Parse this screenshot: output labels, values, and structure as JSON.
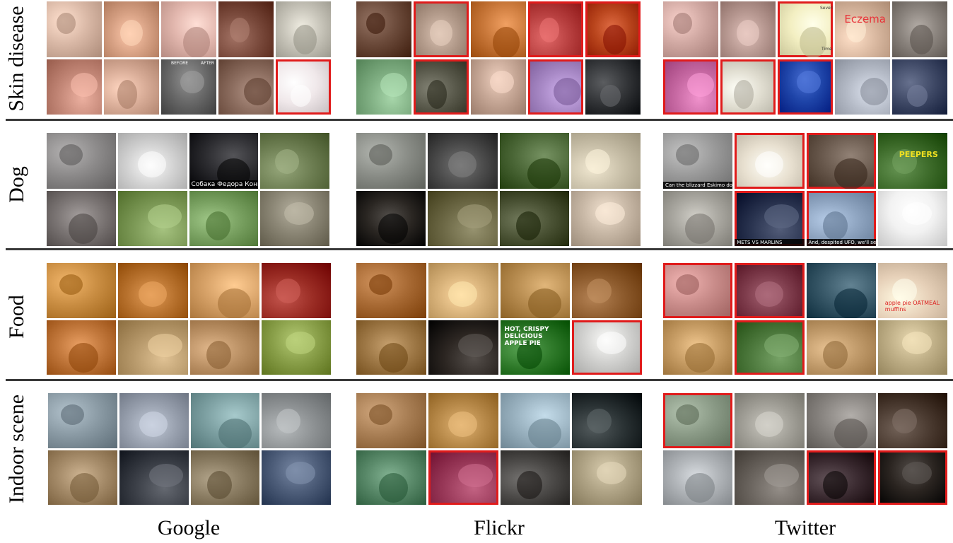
{
  "rows": [
    {
      "id": "skin",
      "label": "Skin disease"
    },
    {
      "id": "dog",
      "label": "Dog"
    },
    {
      "id": "food",
      "label": "Food"
    },
    {
      "id": "indoor",
      "label": "Indoor scene"
    }
  ],
  "columns": [
    {
      "id": "google",
      "label": "Google"
    },
    {
      "id": "flickr",
      "label": "Flickr"
    },
    {
      "id": "twitter",
      "label": "Twitter"
    }
  ],
  "image_texts": {
    "skin_google_before": "BEFORE",
    "skin_google_after": "AFTER",
    "skin_twitter_eczema": "Eczema",
    "skin_twitter_chart_severity": "Severity",
    "skin_twitter_chart_time": "Time",
    "dog_google_caption": "Собака Федора Конюхова",
    "dog_twitter_peepers": "PEEPERS",
    "dog_twitter_caption1": "Can the blizzard Eskimo dog come in so you we there?",
    "dog_twitter_caption2": "METS VS MARLINS",
    "dog_twitter_caption3": "And, despited UFO, we'll see great. You want the to - You",
    "food_flickr_box": "HOT, CRISPY DELICIOUS APPLE PIE",
    "food_twitter_muffins": "apple pie OATMEAL muffins"
  },
  "cells": {
    "skin_google": [
      {
        "c": "#d9b8a6",
        "n": false
      },
      {
        "c": "#d7a184",
        "n": false
      },
      {
        "c": "#e2b7ae",
        "n": false
      },
      {
        "c": "#7a4a3c",
        "n": false
      },
      {
        "c": "#c9c6bb",
        "n": false
      },
      {
        "c": "#c48878",
        "n": false
      },
      {
        "c": "#d9ad98",
        "n": false
      },
      {
        "c": "#6a6a6a",
        "n": false
      },
      {
        "c": "#8c6d5f",
        "n": false
      },
      {
        "c": "#f0e8ea",
        "n": true
      }
    ],
    "skin_flickr": [
      {
        "c": "#6b4a3a",
        "n": false
      },
      {
        "c": "#b29a8a",
        "n": true
      },
      {
        "c": "#c9783a",
        "n": false
      },
      {
        "c": "#b84040",
        "n": true
      },
      {
        "c": "#b8441c",
        "n": true
      },
      {
        "c": "#7fae82",
        "n": false
      },
      {
        "c": "#5a5a4c",
        "n": true
      },
      {
        "c": "#c6a796",
        "n": false
      },
      {
        "c": "#a889c6",
        "n": true
      },
      {
        "c": "#333538",
        "n": false
      }
    ],
    "skin_twitter": [
      {
        "c": "#d0a8a2",
        "n": false
      },
      {
        "c": "#b89992",
        "n": false
      },
      {
        "c": "#f3efc2",
        "n": true
      },
      {
        "c": "#d9b8a0",
        "n": false
      },
      {
        "c": "#8c857f",
        "n": false
      },
      {
        "c": "#c86aa4",
        "n": true
      },
      {
        "c": "#e0ddd0",
        "n": true
      },
      {
        "c": "#1e44a8",
        "n": true
      },
      {
        "c": "#b6bcc8",
        "n": false
      },
      {
        "c": "#3f4966",
        "n": false
      }
    ],
    "dog_google": [
      {
        "c": "#8c8a8a",
        "n": false
      },
      {
        "c": "#d2d2d2",
        "n": false
      },
      {
        "c": "#2c2c30",
        "n": false
      },
      {
        "c": "#6d7e52",
        "n": false
      },
      {
        "c": "#7c7675",
        "n": false
      },
      {
        "c": "#7d9a57",
        "n": false
      },
      {
        "c": "#78a060",
        "n": false
      },
      {
        "c": "#8b8675",
        "n": false
      }
    ],
    "dog_flickr": [
      {
        "c": "#8a8d87",
        "n": false
      },
      {
        "c": "#4b4b4b",
        "n": false
      },
      {
        "c": "#4e6a3a",
        "n": false
      },
      {
        "c": "#c8bfa8",
        "n": false
      },
      {
        "c": "#2a2622",
        "n": false
      },
      {
        "c": "#6e6a47",
        "n": false
      },
      {
        "c": "#4a5234",
        "n": false
      },
      {
        "c": "#c8b8a6",
        "n": false
      }
    ],
    "dog_twitter": [
      {
        "c": "#9a9a9a",
        "n": false
      },
      {
        "c": "#e8e0d0",
        "n": true
      },
      {
        "c": "#6a5a4e",
        "n": true
      },
      {
        "c": "#3d6b2a",
        "n": false
      },
      {
        "c": "#a9a7a0",
        "n": false
      },
      {
        "c": "#2a3450",
        "n": true
      },
      {
        "c": "#8ea4c0",
        "n": true
      },
      {
        "c": "#f2f2f2",
        "n": false
      }
    ],
    "food_google": [
      {
        "c": "#c98d42",
        "n": false
      },
      {
        "c": "#b8722e",
        "n": false
      },
      {
        "c": "#d9a46a",
        "n": false
      },
      {
        "c": "#9a2c24",
        "n": false
      },
      {
        "c": "#c2783c",
        "n": false
      },
      {
        "c": "#b89a6c",
        "n": false
      },
      {
        "c": "#ba9064",
        "n": false
      },
      {
        "c": "#8aa04a",
        "n": false
      }
    ],
    "food_flickr": [
      {
        "c": "#a86a34",
        "n": false
      },
      {
        "c": "#d8b27a",
        "n": false
      },
      {
        "c": "#b98e52",
        "n": false
      },
      {
        "c": "#8c5a2c",
        "n": false
      },
      {
        "c": "#a07a48",
        "n": false
      },
      {
        "c": "#2c2622",
        "n": false
      },
      {
        "c": "#2f7a2a",
        "n": false
      },
      {
        "c": "#d2d2d0",
        "n": true
      }
    ],
    "food_twitter": [
      {
        "c": "#c98c8a",
        "n": true
      },
      {
        "c": "#7c3a4a",
        "n": true
      },
      {
        "c": "#3a5a6a",
        "n": false
      },
      {
        "c": "#e6d0b8",
        "n": false
      },
      {
        "c": "#c89e66",
        "n": false
      },
      {
        "c": "#4e7a3e",
        "n": true
      },
      {
        "c": "#c09a6a",
        "n": false
      },
      {
        "c": "#c0b088",
        "n": false
      }
    ],
    "indoor_google": [
      {
        "c": "#8a9aa4",
        "n": false
      },
      {
        "c": "#9aa2b0",
        "n": false
      },
      {
        "c": "#7fa2a4",
        "n": false
      },
      {
        "c": "#8e9294",
        "n": false
      },
      {
        "c": "#a68c6a",
        "n": false
      },
      {
        "c": "#3c4048",
        "n": false
      },
      {
        "c": "#8a7c62",
        "n": false
      },
      {
        "c": "#4e5e7a",
        "n": false
      }
    ],
    "indoor_flickr": [
      {
        "c": "#a87e54",
        "n": false
      },
      {
        "c": "#b88a4a",
        "n": false
      },
      {
        "c": "#9cb4c2",
        "n": false
      },
      {
        "c": "#2a3234",
        "n": false
      },
      {
        "c": "#5a8a6a",
        "n": false
      },
      {
        "c": "#9a3a5a",
        "n": true
      },
      {
        "c": "#4c4a48",
        "n": false
      },
      {
        "c": "#b0a486",
        "n": false
      }
    ],
    "indoor_twitter": [
      {
        "c": "#8a9a86",
        "n": true
      },
      {
        "c": "#a2a098",
        "n": false
      },
      {
        "c": "#8a8682",
        "n": false
      },
      {
        "c": "#4a3a30",
        "n": false
      },
      {
        "c": "#b0b4b8",
        "n": false
      },
      {
        "c": "#6c6660",
        "n": false
      },
      {
        "c": "#3a2a30",
        "n": true
      },
      {
        "c": "#2a2420",
        "n": true
      }
    ]
  }
}
